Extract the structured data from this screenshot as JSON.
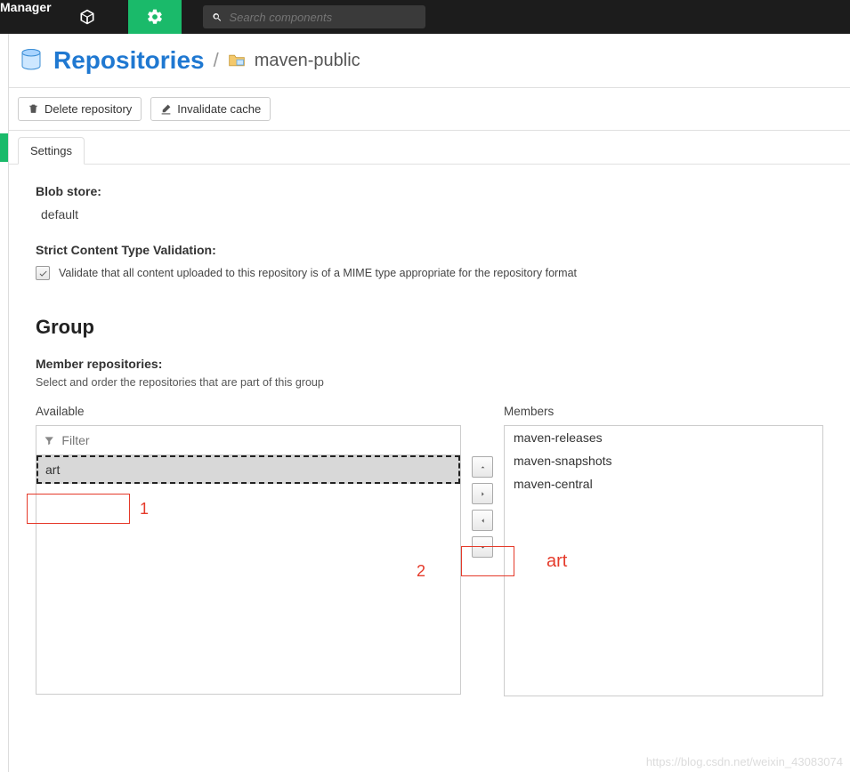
{
  "topbar": {
    "brand_fragment": "Manager",
    "search_placeholder": "Search components"
  },
  "breadcrumb": {
    "section": "Repositories",
    "page": "maven-public"
  },
  "actions": {
    "delete_label": "Delete repository",
    "invalidate_label": "Invalidate cache"
  },
  "tabs": {
    "settings": "Settings"
  },
  "blob_store": {
    "label": "Blob store:",
    "value": "default"
  },
  "strict_validation": {
    "label": "Strict Content Type Validation:",
    "desc": "Validate that all content uploaded to this repository is of a MIME type appropriate for the repository format"
  },
  "group": {
    "heading": "Group",
    "label": "Member repositories:",
    "desc": "Select and order the repositories that are part of this group",
    "available_h": "Available",
    "members_h": "Members",
    "filter_placeholder": "Filter",
    "available_items": [
      "art"
    ],
    "member_items": [
      "maven-releases",
      "maven-snapshots",
      "maven-central"
    ]
  },
  "annotations": {
    "label1": "1",
    "label2": "2",
    "label3": "art"
  },
  "watermark": "https://blog.csdn.net/weixin_43083074"
}
